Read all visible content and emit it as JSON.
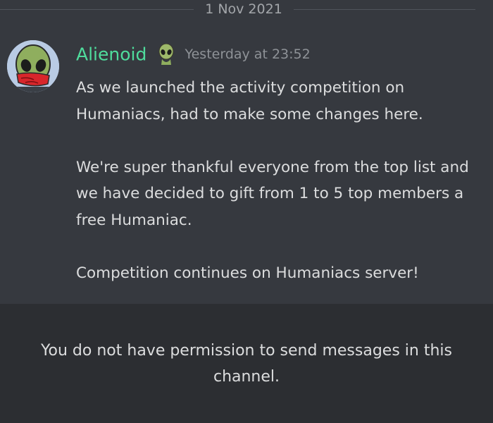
{
  "divider": {
    "date": "1 Nov 2021"
  },
  "message": {
    "author": "Alienoid",
    "role_icon": "alien-icon",
    "timestamp": "Yesterday at 23:52",
    "paragraphs": [
      "As we launched the activity competition on Humaniacs, had to make some changes here.",
      "We're super thankful everyone from the top list and we have decided to gift from 1 to 5 top members a free Humaniac.",
      "Competition continues on Humaniacs server!"
    ]
  },
  "composer": {
    "no_permission_text": "You do not have permission to send messages in this channel."
  },
  "colors": {
    "background": "#36393f",
    "username": "#4fdc9c",
    "text": "#dcddde",
    "muted": "#8e9297",
    "notice_background": "#2c2e32"
  }
}
